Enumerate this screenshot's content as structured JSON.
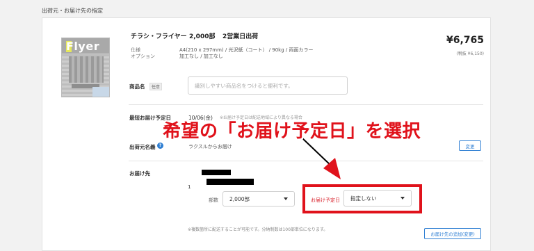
{
  "section_title": "出荷元・お届け先の指定",
  "product": {
    "name": "チラシ・フライヤー",
    "quantity": "2,000部",
    "shipping": "2営業日出荷",
    "thumbnail_text": "Flyer",
    "specs": [
      {
        "label": "仕様",
        "value": "A4(210 x 297mm) / 光沢紙（コート） / 90kg / 両面カラー"
      },
      {
        "label": "オプション",
        "value": "加工なし / 加工なし"
      }
    ],
    "price": "¥6,765",
    "price_tax": "(税抜 ¥6,150)"
  },
  "item_name": {
    "label": "商品名",
    "badge": "任意",
    "placeholder": "識別しやすい商品名をつけると便利です。"
  },
  "delivery_date": {
    "label": "最短お届け予定日",
    "value": "10/06(金)",
    "note": "※お届け予定日は配送地域により異なる場合"
  },
  "origin": {
    "label": "出荷元名義",
    "help_icon": "?",
    "value": "ラクスルからお届け",
    "change_button": "変更"
  },
  "destination": {
    "label": "お届け先",
    "index": "1",
    "qty_label": "部数",
    "qty_value": "2,000部",
    "date_label": "お届け予定日",
    "date_value": "指定しない"
  },
  "annotation": "希望の「お届け予定日」を選択",
  "footer": {
    "note": "※複数箇所に配送することが可能です。分納制数は100部単位になります。",
    "add_button": "お届け先の追加(変更)"
  },
  "colors": {
    "accent_blue": "#2f7fd3",
    "highlight_red": "#e0121b"
  }
}
